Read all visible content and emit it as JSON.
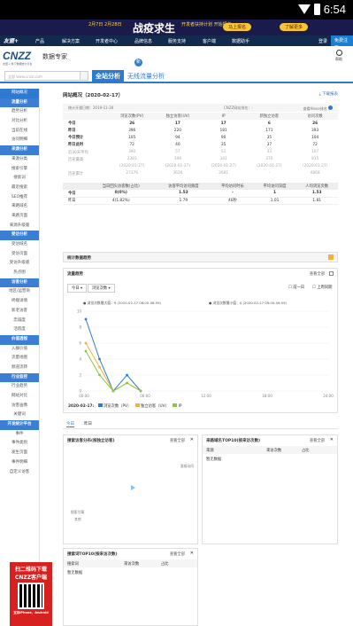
{
  "statusbar": {
    "time": "6:54"
  },
  "banner": {
    "text1": "2月7日 2月28日",
    "text2": "战疫求生",
    "text3": "开发者扶持计划 开始报名",
    "btn1": "马上报名",
    "btn2": "了解更多"
  },
  "topnav": {
    "logo": "友盟+",
    "items": [
      "产品",
      "解决方案",
      "开发者中心",
      "品牌信息",
      "服务支持",
      "客户端",
      "数据助手"
    ],
    "right": [
      "登录",
      "免费注册"
    ]
  },
  "header": {
    "brand": "CNZZ",
    "brand_sub": "友盟+ 旗下数据统计平台",
    "title": "数据专家",
    "help": "帮助"
  },
  "tabs": {
    "site_placeholder": "全部 www.cnzz.com",
    "tab1": "全站分析",
    "tab2": "无线流量分析",
    "bubble": "新"
  },
  "sidebar": {
    "items": [
      {
        "label": "网站概况",
        "type": "top"
      },
      {
        "label": "流量分析",
        "type": "head"
      },
      {
        "label": "趋势分析",
        "type": "item"
      },
      {
        "label": "对比分析",
        "type": "item"
      },
      {
        "label": "当前在线",
        "type": "item"
      },
      {
        "label": "访问明细",
        "type": "item"
      },
      {
        "label": "来源分析",
        "type": "head"
      },
      {
        "label": "来源分类",
        "type": "item"
      },
      {
        "label": "搜索引擎",
        "type": "item"
      },
      {
        "label": "搜索词",
        "type": "item"
      },
      {
        "label": "最近搜索",
        "type": "item"
      },
      {
        "label": "SEO推荐",
        "type": "item"
      },
      {
        "label": "来路域名",
        "type": "item"
      },
      {
        "label": "来路页面",
        "type": "item"
      },
      {
        "label": "来源升级版",
        "type": "item"
      },
      {
        "label": "受访分析",
        "type": "head"
      },
      {
        "label": "受访域名",
        "type": "item"
      },
      {
        "label": "受访页面",
        "type": "item"
      },
      {
        "label": "受访升级版",
        "type": "item"
      },
      {
        "label": "热点图",
        "type": "item"
      },
      {
        "label": "访客分析",
        "type": "head"
      },
      {
        "label": "地区/运营商",
        "type": "item"
      },
      {
        "label": "终端详情",
        "type": "item"
      },
      {
        "label": "新老访客",
        "type": "item"
      },
      {
        "label": "忠诚度",
        "type": "item"
      },
      {
        "label": "活跃度",
        "type": "item"
      },
      {
        "label": "价值透视",
        "type": "head"
      },
      {
        "label": "入群价值",
        "type": "item"
      },
      {
        "label": "流量地图",
        "type": "item"
      },
      {
        "label": "频道流转",
        "type": "item"
      },
      {
        "label": "行业监控",
        "type": "head"
      },
      {
        "label": "行业趋势",
        "type": "item"
      },
      {
        "label": "网站对比",
        "type": "item"
      },
      {
        "label": "访客画像",
        "type": "item"
      },
      {
        "label": "关键词",
        "type": "item"
      },
      {
        "label": "开发统计平台",
        "type": "head"
      },
      {
        "label": "事件",
        "type": "item"
      },
      {
        "label": "事件类别",
        "type": "item"
      },
      {
        "label": "发生页面",
        "type": "item"
      },
      {
        "label": "事件明细",
        "type": "item"
      },
      {
        "label": "自定义访客",
        "type": "item"
      }
    ]
  },
  "ad": {
    "line1": "扫二维码下载",
    "line2": "CNZZ客户端",
    "line3": "支持iPhone、Android"
  },
  "overview": {
    "title": "网站概况（2020-02-17）",
    "download": "下载报表",
    "start_date": "统计开通日期：2019-11-30",
    "rank": "CNZZ网站排名：-",
    "alexa": "查看Alexa排名",
    "columns": [
      "",
      "浏览次数(PV)",
      "独立访客(UV)",
      "IP",
      "新独立访客",
      "访问次数"
    ],
    "rows": [
      {
        "label": "今日",
        "vals": [
          "26",
          "17",
          "17",
          "6",
          "26"
        ],
        "style": "bold"
      },
      {
        "label": "昨日",
        "vals": [
          "396",
          "220",
          "181",
          "171",
          "393"
        ],
        "style": "normal"
      },
      {
        "label": "今日预计",
        "vals": [
          "105",
          "94",
          "90",
          "35",
          "104"
        ],
        "style": "normal"
      },
      {
        "label": "昨日此时",
        "vals": [
          "72",
          "40",
          "35",
          "37",
          "72"
        ],
        "style": "normal"
      },
      {
        "label": "近30天平均",
        "vals": [
          "390",
          "57",
          "51",
          "33",
          "107"
        ],
        "style": "gray"
      },
      {
        "label": "历史最高",
        "vals": [
          "2383",
          "399",
          "341",
          "370",
          "915"
        ],
        "style": "gray"
      },
      {
        "label": "",
        "vals": [
          "(2020-01-27)",
          "(2020-01-27)",
          "(2020-01-27)",
          "(2020-01-27)",
          "(2020-01-27)"
        ],
        "style": "gray"
      },
      {
        "label": "历史累计",
        "vals": [
          "27376",
          "3626",
          "2681",
          "-",
          "4868"
        ],
        "style": "gray"
      }
    ]
  },
  "quality": {
    "columns": [
      "",
      "当日回头访客数(占比)",
      "访客平均访问频度",
      "平均访问时长",
      "平均访问深度",
      "人均浏览页数"
    ],
    "rows": [
      {
        "label": "今日",
        "vals": [
          "0(0%)",
          "1.53",
          "-",
          "1",
          "1.53"
        ],
        "style": "bold"
      },
      {
        "label": "昨日",
        "vals": [
          "4(1.82%)",
          "1.79",
          "40秒",
          "1.01",
          "1.81"
        ],
        "style": "normal"
      }
    ]
  },
  "trend": {
    "section": "统计数据趋势",
    "panel_title": "流量趋势",
    "view_all": "查看全部",
    "sel1": "今日",
    "sel2": "浏览次数",
    "cmp1": "前一日",
    "cmp2": "上周同期",
    "tip1": "浏览次数最大值：9 (2020-02-17 08:00-08:59)",
    "tip2": "浏览次数最小值：0 (2020-02-17 09:00-09:59)",
    "legend_date": "2020-02-17:",
    "legend": [
      "浏览次数（PV）",
      "独立访客（UV）",
      "IP"
    ]
  },
  "chart_data": {
    "type": "line",
    "x": [
      "00:00",
      "",
      "06:00",
      "",
      "12:00",
      "",
      "18:00",
      "",
      "24:00"
    ],
    "series": [
      {
        "name": "浏览次数（PV）",
        "color": "#2f7ad1",
        "values": [
          9,
          4,
          0,
          2,
          0
        ]
      },
      {
        "name": "独立访客（UV）",
        "color": "#f2b233",
        "values": [
          6,
          3,
          0,
          1,
          0
        ]
      },
      {
        "name": "IP",
        "color": "#8dc63f",
        "values": [
          5,
          2,
          0,
          1,
          0
        ]
      }
    ],
    "yticks": [
      0,
      2,
      4,
      6,
      8,
      10
    ],
    "ylim": [
      0,
      10
    ]
  },
  "source": {
    "tab1": "今日",
    "tab2": "昨日",
    "panel1_title": "搜索访客分布(按独立访客)",
    "panel1_view": "查看全部",
    "panel1_labels": [
      "直接访问",
      "其他",
      "搜索引擎"
    ],
    "panel2_title": "来路域名TOP10(按来访次数)",
    "panel2_view": "查看全部",
    "panel2_cols": [
      "来源",
      "来访次数",
      "占比"
    ],
    "panel2_empty": "暂无数据",
    "panel3_title": "搜索词TOP10(按来访次数)",
    "panel3_view": "查看全部",
    "panel3_cols": [
      "搜索词",
      "来访次数",
      "占比"
    ],
    "panel3_empty": "暂无数据"
  },
  "colors": {
    "accent": "#2f7ad1",
    "nav": "#112a4e",
    "banner": "#1b1b4b",
    "ad": "#d7211e"
  }
}
